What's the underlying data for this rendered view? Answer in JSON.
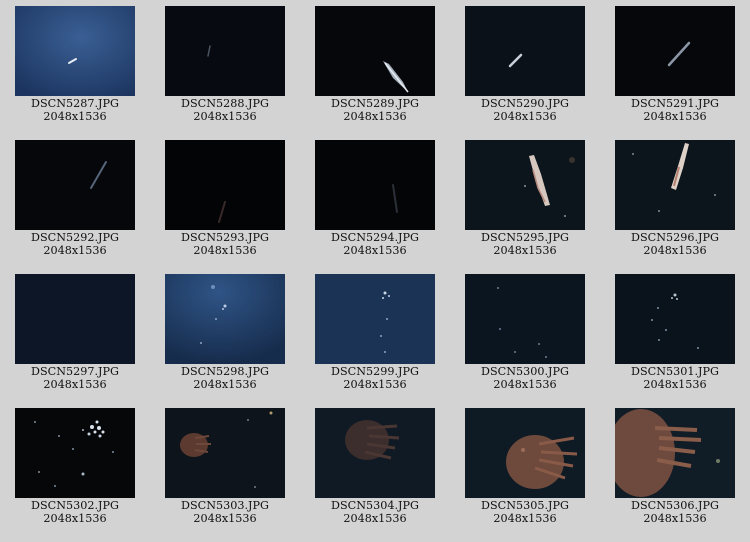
{
  "gallery": {
    "items": [
      {
        "filename": "DSCN5287.JPG",
        "dimensions": "2048x1536"
      },
      {
        "filename": "DSCN5288.JPG",
        "dimensions": "2048x1536"
      },
      {
        "filename": "DSCN5289.JPG",
        "dimensions": "2048x1536"
      },
      {
        "filename": "DSCN5290.JPG",
        "dimensions": "2048x1536"
      },
      {
        "filename": "DSCN5291.JPG",
        "dimensions": "2048x1536"
      },
      {
        "filename": "DSCN5292.JPG",
        "dimensions": "2048x1536"
      },
      {
        "filename": "DSCN5293.JPG",
        "dimensions": "2048x1536"
      },
      {
        "filename": "DSCN5294.JPG",
        "dimensions": "2048x1536"
      },
      {
        "filename": "DSCN5295.JPG",
        "dimensions": "2048x1536"
      },
      {
        "filename": "DSCN5296.JPG",
        "dimensions": "2048x1536"
      },
      {
        "filename": "DSCN5297.JPG",
        "dimensions": "2048x1536"
      },
      {
        "filename": "DSCN5298.JPG",
        "dimensions": "2048x1536"
      },
      {
        "filename": "DSCN5299.JPG",
        "dimensions": "2048x1536"
      },
      {
        "filename": "DSCN5300.JPG",
        "dimensions": "2048x1536"
      },
      {
        "filename": "DSCN5301.JPG",
        "dimensions": "2048x1536"
      },
      {
        "filename": "DSCN5302.JPG",
        "dimensions": "2048x1536"
      },
      {
        "filename": "DSCN5303.JPG",
        "dimensions": "2048x1536"
      },
      {
        "filename": "DSCN5304.JPG",
        "dimensions": "2048x1536"
      },
      {
        "filename": "DSCN5305.JPG",
        "dimensions": "2048x1536"
      },
      {
        "filename": "DSCN5306.JPG",
        "dimensions": "2048x1536"
      }
    ]
  },
  "colors": {
    "page_background": "#d3d3d3",
    "caption_text": "#111111"
  }
}
